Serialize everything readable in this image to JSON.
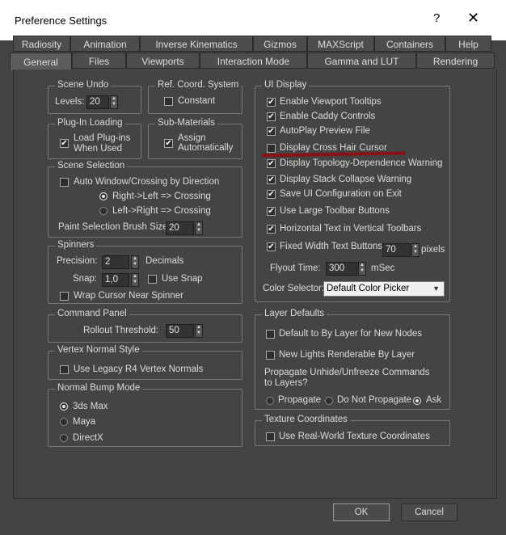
{
  "window": {
    "title": "Preference Settings",
    "help_glyph": "?",
    "close_glyph": "✕"
  },
  "tabs_row1": [
    "Radiosity",
    "Animation",
    "Inverse Kinematics",
    "Gizmos",
    "MAXScript",
    "Containers",
    "Help"
  ],
  "tabs_row2": [
    "General",
    "Files",
    "Viewports",
    "Interaction Mode",
    "Gamma and LUT",
    "Rendering"
  ],
  "active_tab": "General",
  "scene_undo": {
    "title": "Scene Undo",
    "levels_label": "Levels:",
    "levels_value": "20"
  },
  "ref_coord": {
    "title": "Ref. Coord. System",
    "constant_label": "Constant",
    "constant_checked": false
  },
  "plugin_loading": {
    "title": "Plug-In Loading",
    "load_label_1": "Load Plug-ins",
    "load_label_2": "When Used",
    "checked": true
  },
  "sub_materials": {
    "title": "Sub-Materials",
    "assign_label_1": "Assign",
    "assign_label_2": "Automatically",
    "checked": true
  },
  "scene_selection": {
    "title": "Scene Selection",
    "auto_window_label": "Auto Window/Crossing by Direction",
    "auto_window_checked": false,
    "right_left_label": "Right->Left => Crossing",
    "left_right_label": "Left->Right => Crossing",
    "selected_direction": "right-left",
    "brush_size_label": "Paint Selection Brush Size",
    "brush_size_value": "20"
  },
  "spinners": {
    "title": "Spinners",
    "precision_label": "Precision:",
    "precision_value": "2",
    "decimals_label": "Decimals",
    "snap_label": "Snap:",
    "snap_value": "1,0",
    "use_snap_label": "Use Snap",
    "use_snap_checked": false,
    "wrap_label": "Wrap Cursor Near Spinner",
    "wrap_checked": false
  },
  "command_panel": {
    "title": "Command Panel",
    "rollout_label": "Rollout Threshold:",
    "rollout_value": "50"
  },
  "vertex_normal": {
    "title": "Vertex Normal Style",
    "legacy_label": "Use Legacy R4 Vertex Normals",
    "legacy_checked": false
  },
  "normal_bump": {
    "title": "Normal Bump Mode",
    "options": [
      "3ds Max",
      "Maya",
      "DirectX"
    ],
    "selected": "3ds Max"
  },
  "ui_display": {
    "title": "UI Display",
    "items": [
      {
        "label": "Enable Viewport Tooltips",
        "checked": true
      },
      {
        "label": "Enable Caddy Controls",
        "checked": true
      },
      {
        "label": "AutoPlay Preview File",
        "checked": true
      },
      {
        "label": "Display Cross Hair Cursor",
        "checked": false
      },
      {
        "label": "Display Topology-Dependence Warning",
        "checked": true
      },
      {
        "label": "Display Stack Collapse Warning",
        "checked": true
      },
      {
        "label": "Save UI Configuration on Exit",
        "checked": true
      },
      {
        "label": "Use Large Toolbar Buttons",
        "checked": true
      },
      {
        "label": "Horizontal Text in Vertical Toolbars",
        "checked": true
      },
      {
        "label": "Fixed Width Text Buttons:",
        "checked": true
      }
    ],
    "fixed_width_value": "70",
    "pixels_label": "pixels",
    "flyout_label": "Flyout Time:",
    "flyout_value": "300",
    "msec_label": "mSec",
    "color_selector_label": "Color Selector:",
    "color_selector_value": "Default Color Picker"
  },
  "layer_defaults": {
    "title": "Layer Defaults",
    "default_bylayer_label": "Default to By Layer for New Nodes",
    "default_bylayer_checked": false,
    "new_lights_label": "New Lights Renderable By Layer",
    "new_lights_checked": false,
    "propagate_text_1": "Propagate Unhide/Unfreeze Commands",
    "propagate_text_2": "to Layers?",
    "options": [
      "Propagate",
      "Do Not Propagate",
      "Ask"
    ],
    "selected": "Ask"
  },
  "texture_coords": {
    "title": "Texture Coordinates",
    "realworld_label": "Use Real-World Texture Coordinates",
    "realworld_checked": false
  },
  "buttons": {
    "ok_label": "OK",
    "cancel_label": "Cancel"
  },
  "colors": {
    "background": "#444444",
    "highlight_annotation": "#8a1216"
  }
}
